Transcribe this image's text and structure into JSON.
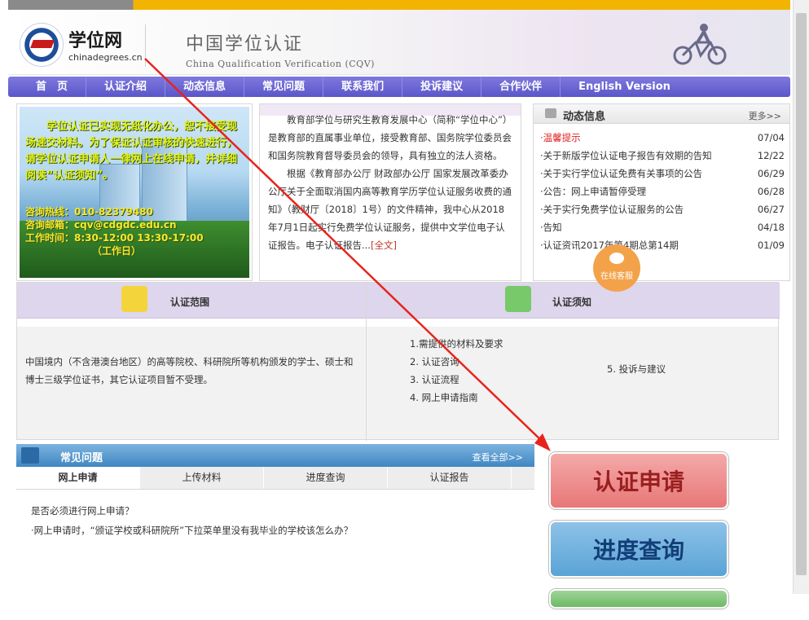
{
  "header": {
    "logo_title": "学位网",
    "logo_sub": "chinadegrees.cn",
    "cqv_cn": "中国学位认证",
    "cqv_en": "China Qualification Verification (CQV)"
  },
  "nav": {
    "items": [
      "首　页",
      "认证介绍",
      "动态信息",
      "常见问题",
      "联系我们",
      "投诉建议",
      "合作伙伴",
      "English Version"
    ]
  },
  "banner": {
    "text": "学位认证已实现无纸化办公，恕不接受现场递交材料。为了保证认证审核的快速进行，请学位认证申请人一律网上在线申请，并详细阅读“认证须知”。",
    "hotline": "咨询热线：010-82379480",
    "email": "咨询邮箱：cqv@cdgdc.edu.cn",
    "hours": "工作时间：8:30-12:00  13:30-17:00",
    "hours2": "（工作日）"
  },
  "intro": {
    "p1": "教育部学位与研究生教育发展中心（简称“学位中心”）是教育部的直属事业单位，接受教育部、国务院学位委员会和国务院教育督导委员会的领导，具有独立的法人资格。",
    "p2": "根据《教育部办公厅 财政部办公厅 国家发展改革委办公厅关于全面取消国内高等教育学历学位认证服务收费的通知》（教财厅〔2018〕1号）的文件精神，我中心从2018年7月1日起实行免费学位认证服务，提供中文学位电子认证报告。电子认证报告...",
    "more_link": "[全文]"
  },
  "news": {
    "title": "动态信息",
    "more": "更多>>",
    "items": [
      {
        "title": "·温馨提示",
        "date": "07/04"
      },
      {
        "title": "·关于新版学位认证电子报告有效期的告知",
        "date": "12/22"
      },
      {
        "title": "·关于实行学位认证免费有关事项的公告",
        "date": "06/29"
      },
      {
        "title": "·公告：网上申请暂停受理",
        "date": "06/28"
      },
      {
        "title": "·关于实行免费学位认证服务的公告",
        "date": "06/27"
      },
      {
        "title": "·告知",
        "date": "04/18"
      },
      {
        "title": "·认证资讯2017年第4期总第14期",
        "date": "01/09"
      }
    ]
  },
  "chat": {
    "label": "在线客服"
  },
  "scope": {
    "title": "认证范围",
    "text": "中国境内（不含港澳台地区）的高等院校、科研院所等机构颁发的学士、硕士和博士三级学位证书，其它认证项目暂不受理。"
  },
  "notice": {
    "title": "认证须知",
    "items": [
      "1.需提供的材料及要求",
      "2. 认证咨询",
      "3. 认证流程",
      "4. 网上申请指南"
    ],
    "item5": "5. 投诉与建议"
  },
  "faq": {
    "title": "常见问题",
    "more": "查看全部>>",
    "tabs": [
      "网上申请",
      "上传材料",
      "进度查询",
      "认证报告"
    ],
    "questions": [
      "是否必须进行网上申请？",
      "·网上申请时，“颁证学校或科研院所”下拉菜单里没有我毕业的学校该怎么办？"
    ]
  },
  "side": {
    "apply": "认证申请",
    "progress": "进度查询"
  },
  "colors": {
    "nav": "#5a56c8",
    "accent_orange": "#f2b400",
    "arrow": "#e8231c",
    "apply_button": "#e87777",
    "progress_button": "#5aa3d6"
  }
}
